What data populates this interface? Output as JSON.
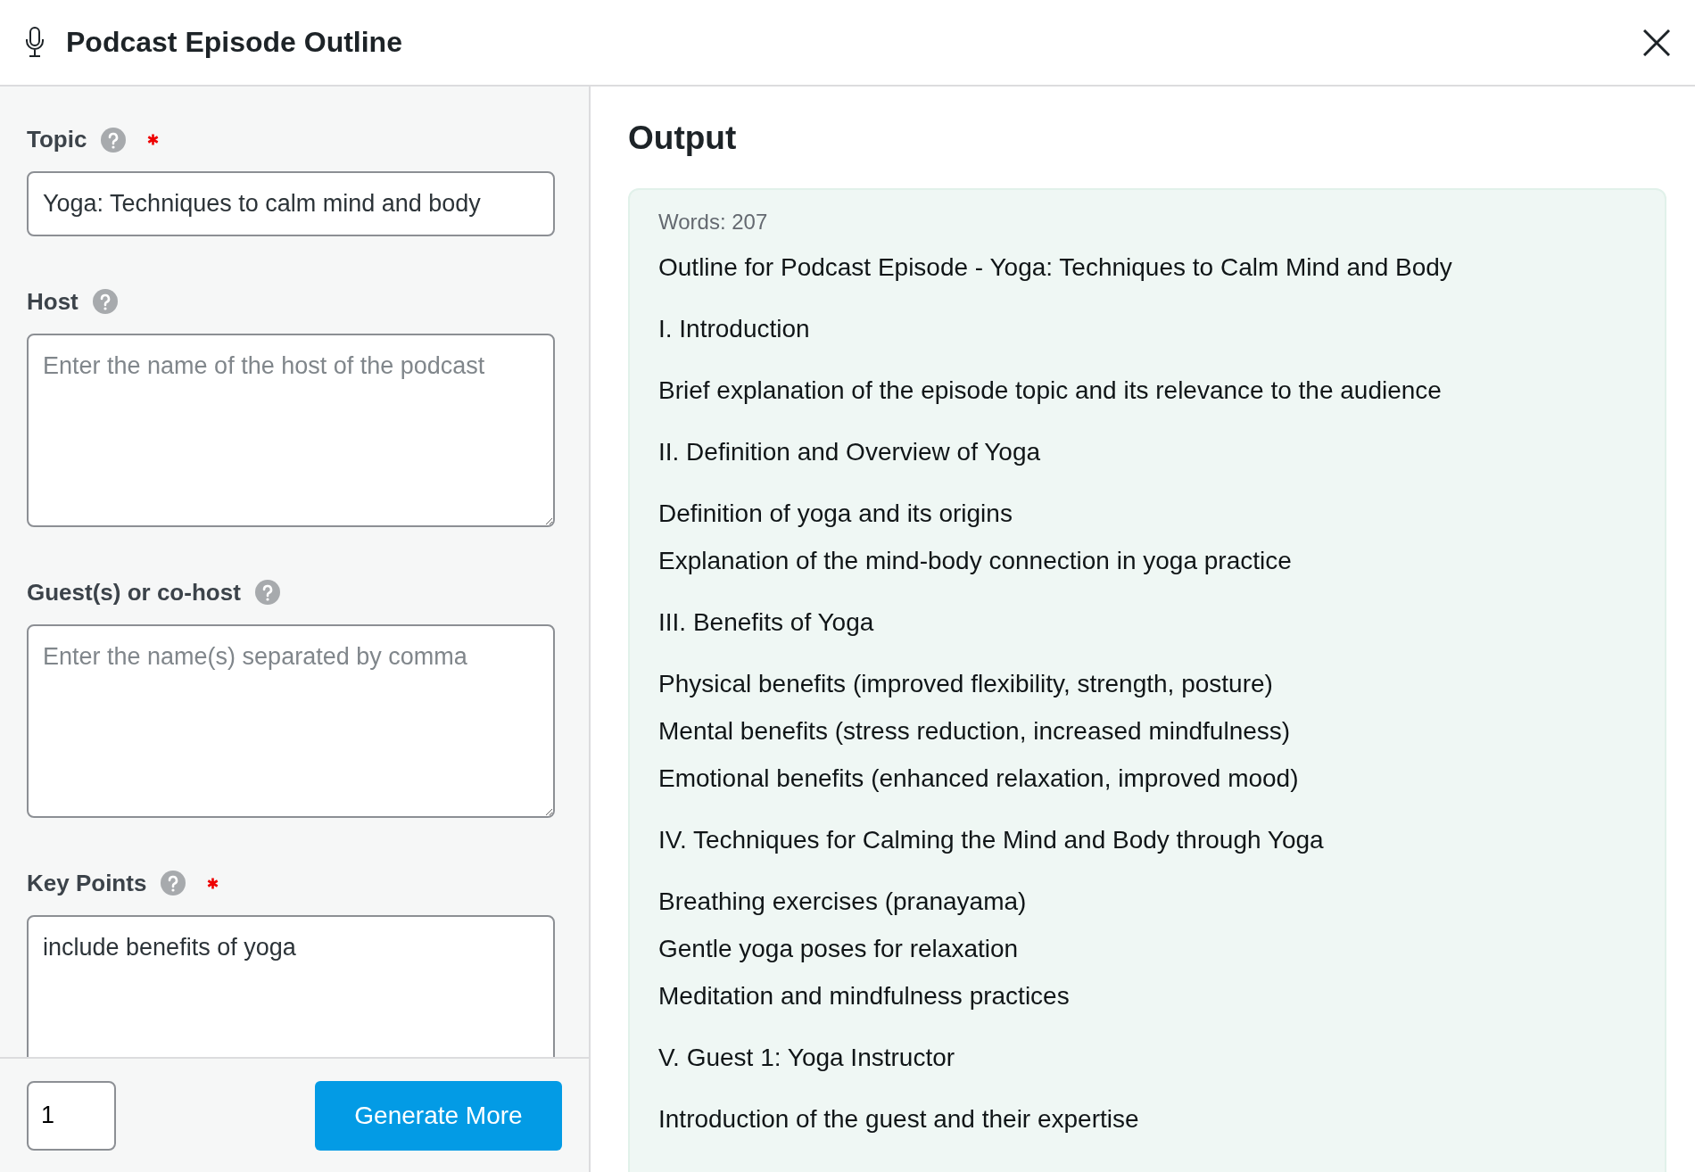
{
  "window": {
    "title": "Podcast Episode Outline"
  },
  "fields": [
    {
      "label": "Topic",
      "kind": "input",
      "required": true,
      "value": "Yoga: Techniques to calm mind and body"
    },
    {
      "label": "Host",
      "kind": "textarea",
      "required": false,
      "placeholder": "Enter the name of the host of the podcast"
    },
    {
      "label": "Guest(s) or co-host",
      "kind": "textarea",
      "required": false,
      "placeholder": "Enter the name(s) separated by comma"
    },
    {
      "label": "Key Points",
      "kind": "textarea",
      "required": true,
      "value": "include benefits of yoga"
    }
  ],
  "footer": {
    "count": "1",
    "button": "Generate More"
  },
  "output": {
    "title": "Output",
    "word_count": "Words: 207",
    "groups": [
      [
        "Outline for Podcast Episode - Yoga: Techniques to Calm Mind and Body"
      ],
      [
        "I. Introduction"
      ],
      [
        "Brief explanation of the episode topic and its relevance to the audience"
      ],
      [
        "II. Definition and Overview of Yoga"
      ],
      [
        "Definition of yoga and its origins",
        "Explanation of the mind-body connection in yoga practice"
      ],
      [
        "III. Benefits of Yoga"
      ],
      [
        "Physical benefits (improved flexibility, strength, posture)",
        "Mental benefits (stress reduction, increased mindfulness)",
        "Emotional benefits (enhanced relaxation, improved mood)"
      ],
      [
        "IV. Techniques for Calming the Mind and Body through Yoga"
      ],
      [
        "Breathing exercises (pranayama)",
        "Gentle yoga poses for relaxation",
        "Meditation and mindfulness practices"
      ],
      [
        "V. Guest 1: Yoga Instructor"
      ],
      [
        "Introduction of the guest and their expertise"
      ]
    ]
  }
}
